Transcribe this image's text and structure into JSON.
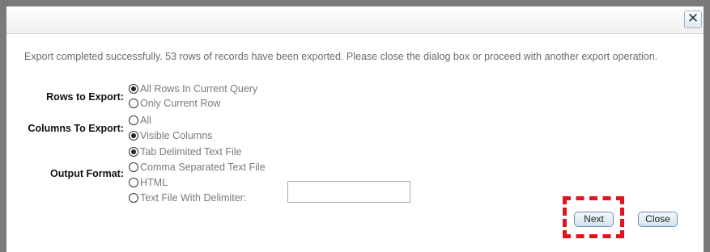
{
  "dialog": {
    "close_glyph": "✕",
    "message": "Export completed successfully. 53 rows of records have been exported. Please close the dialog box or proceed with another export operation."
  },
  "rows_to_export": {
    "label": "Rows to Export:",
    "options": [
      {
        "label": "All Rows In Current Query",
        "selected": true
      },
      {
        "label": "Only Current Row",
        "selected": false
      }
    ]
  },
  "columns_to_export": {
    "label": "Columns To Export:",
    "options": [
      {
        "label": "All",
        "selected": false
      },
      {
        "label": "Visible Columns",
        "selected": true
      }
    ]
  },
  "output_format": {
    "label": "Output Format:",
    "options": [
      {
        "label": "Tab Delimited Text File",
        "selected": true
      },
      {
        "label": "Comma Separated Text File",
        "selected": false
      },
      {
        "label": "HTML",
        "selected": false
      },
      {
        "label": "Text File With Delimiter:",
        "selected": false
      }
    ],
    "delimiter_value": ""
  },
  "buttons": {
    "next_label": "Next",
    "close_label": "Close"
  },
  "colors": {
    "highlight": "#e0141e",
    "frame": "#7a7a7a"
  }
}
